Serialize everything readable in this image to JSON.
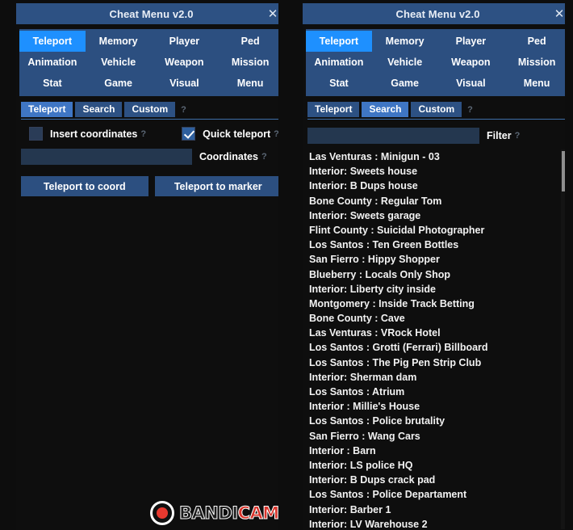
{
  "window": {
    "title": "Cheat Menu v2.0",
    "close_icon": "close-icon",
    "close_glyph": "✕"
  },
  "nav": {
    "items": [
      "Teleport",
      "Memory",
      "Player",
      "Ped",
      "Animation",
      "Vehicle",
      "Weapon",
      "Mission",
      "Stat",
      "Game",
      "Visual",
      "Menu"
    ],
    "active": "Teleport"
  },
  "subtabs": {
    "items": [
      "Teleport",
      "Search",
      "Custom"
    ],
    "help_glyph": "?",
    "left_active": "Teleport",
    "right_active": "Search"
  },
  "left_panel": {
    "checkbox_insert": {
      "label": "Insert coordinates",
      "checked": false,
      "help": "?"
    },
    "checkbox_quick": {
      "label": "Quick teleport",
      "checked": true,
      "help": "?"
    },
    "coordinates_input": {
      "value": "",
      "placeholder": "",
      "label": "Coordinates",
      "help": "?"
    },
    "buttons": {
      "teleport_coord": "Teleport to coord",
      "teleport_marker": "Teleport to marker"
    }
  },
  "right_panel": {
    "filter_input": {
      "value": "",
      "placeholder": "",
      "label": "Filter",
      "help": "?"
    },
    "locations": [
      "Las Venturas : Minigun - 03",
      "Interior: Sweets house",
      "Interior: B Dups house",
      "Bone County : Regular Tom",
      "Interior: Sweets garage",
      "Flint County : Suicidal Photographer",
      "Los Santos : Ten Green Bottles",
      "San Fierro : Hippy Shopper",
      "Blueberry : Locals Only Shop",
      "Interior: Liberty city inside",
      "Montgomery : Inside Track Betting",
      "Bone County : Cave",
      "Las Venturas : VRock Hotel",
      "Los Santos : Grotti (Ferrari) Billboard",
      "Los Santos : The Pig Pen Strip Club",
      "Interior: Sherman dam",
      "Los Santos : Atrium",
      "Interior : Millie's House",
      "Los Santos : Police brutality",
      "San Fierro : Wang Cars",
      "Interior : Barn",
      "Interior: LS police HQ",
      "Interior: B Dups crack pad",
      "Los Santos : Police Departament",
      "Interior: Barber 1",
      "Interior: LV Warehouse 2"
    ]
  },
  "watermark": {
    "band": "BANDI",
    "cam": "CAM",
    "icon": "record-dot-icon"
  },
  "colors": {
    "accent_active": "#1e90ff",
    "panel_blue": "#2c4f80",
    "titlebar_blue": "#2d5183",
    "subtab_active": "#3f76c4",
    "input_blue": "#24374f",
    "background": "#2a2e26"
  }
}
